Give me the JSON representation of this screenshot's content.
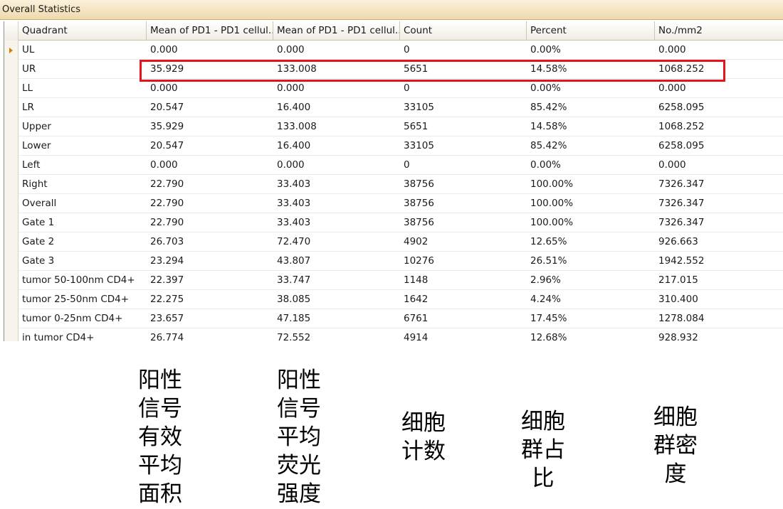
{
  "panel": {
    "title": "Overall Statistics",
    "highlight_color": "#e8131a",
    "accent_arrow_color": "#d77a00"
  },
  "columns": [
    "Quadrant",
    "Mean of PD1 - PD1 cellul...",
    "Mean of PD1 - PD1 cellul...",
    "Count",
    "Percent",
    "No./mm2"
  ],
  "rows": [
    [
      "UL",
      "0.000",
      "0.000",
      "0",
      "0.00%",
      "0.000"
    ],
    [
      "UR",
      "35.929",
      "133.008",
      "5651",
      "14.58%",
      "1068.252"
    ],
    [
      "LL",
      "0.000",
      "0.000",
      "0",
      "0.00%",
      "0.000"
    ],
    [
      "LR",
      "20.547",
      "16.400",
      "33105",
      "85.42%",
      "6258.095"
    ],
    [
      "Upper",
      "35.929",
      "133.008",
      "5651",
      "14.58%",
      "1068.252"
    ],
    [
      "Lower",
      "20.547",
      "16.400",
      "33105",
      "85.42%",
      "6258.095"
    ],
    [
      "Left",
      "0.000",
      "0.000",
      "0",
      "0.00%",
      "0.000"
    ],
    [
      "Right",
      "22.790",
      "33.403",
      "38756",
      "100.00%",
      "7326.347"
    ],
    [
      "Overall",
      "22.790",
      "33.403",
      "38756",
      "100.00%",
      "7326.347"
    ],
    [
      "Gate 1",
      "22.790",
      "33.403",
      "38756",
      "100.00%",
      "7326.347"
    ],
    [
      "Gate 2",
      "26.703",
      "72.470",
      "4902",
      "12.65%",
      "926.663"
    ],
    [
      "Gate 3",
      "23.294",
      "43.807",
      "10276",
      "26.51%",
      "1942.552"
    ],
    [
      "tumor 50-100nm CD4+",
      "22.397",
      "33.747",
      "1148",
      "2.96%",
      "217.015"
    ],
    [
      "tumor 25-50nm CD4+",
      "22.275",
      "38.085",
      "1642",
      "4.24%",
      "310.400"
    ],
    [
      "tumor 0-25nm CD4+",
      "23.657",
      "47.185",
      "6761",
      "17.45%",
      "1278.084"
    ],
    [
      "in tumor CD4+",
      "26.774",
      "72.552",
      "4914",
      "12.68%",
      "928.932"
    ]
  ],
  "current_row_index": 0,
  "highlighted_row_index": 1,
  "annotations": [
    {
      "lines": [
        "阳性",
        "信号",
        "有效",
        "平均",
        "面积"
      ]
    },
    {
      "lines": [
        "阳性",
        "信号",
        "平均",
        "荧光",
        "强度"
      ]
    },
    {
      "lines": [
        "细胞",
        "计数"
      ]
    },
    {
      "lines": [
        "细胞",
        "群占",
        "比"
      ]
    },
    {
      "lines": [
        "细胞",
        "群密",
        "度"
      ]
    }
  ]
}
